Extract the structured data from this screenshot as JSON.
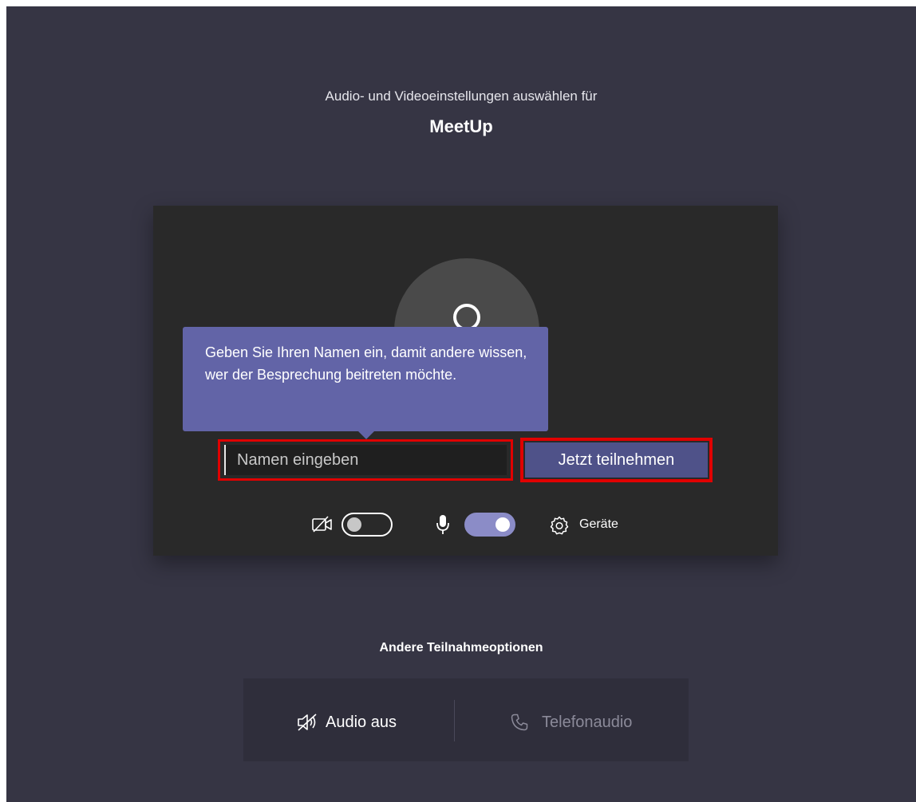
{
  "header": {
    "subtitle": "Audio- und Videoeinstellungen auswählen für",
    "meeting_title": "MeetUp"
  },
  "tooltip": {
    "text": "Geben Sie Ihren Namen ein, damit andere wissen, wer der Besprechung beitreten möchte."
  },
  "name_input": {
    "placeholder": "Namen eingeben",
    "value": ""
  },
  "join_button": {
    "label": "Jetzt teilnehmen"
  },
  "controls": {
    "video": {
      "icon": "camera-off-icon",
      "state": "off"
    },
    "mic": {
      "icon": "microphone-icon",
      "state": "on"
    },
    "devices": {
      "icon": "gear-icon",
      "label": "Geräte"
    }
  },
  "other_options": {
    "heading": "Andere Teilnahmeoptionen",
    "audio_off": {
      "icon": "speaker-off-icon",
      "label": "Audio aus"
    },
    "phone_audio": {
      "icon": "phone-icon",
      "label": "Telefonaudio"
    }
  },
  "colors": {
    "background": "#363544",
    "panel": "#292929",
    "accent": "#6264a7",
    "join_button": "#4f5289",
    "highlight": "#e00000"
  }
}
